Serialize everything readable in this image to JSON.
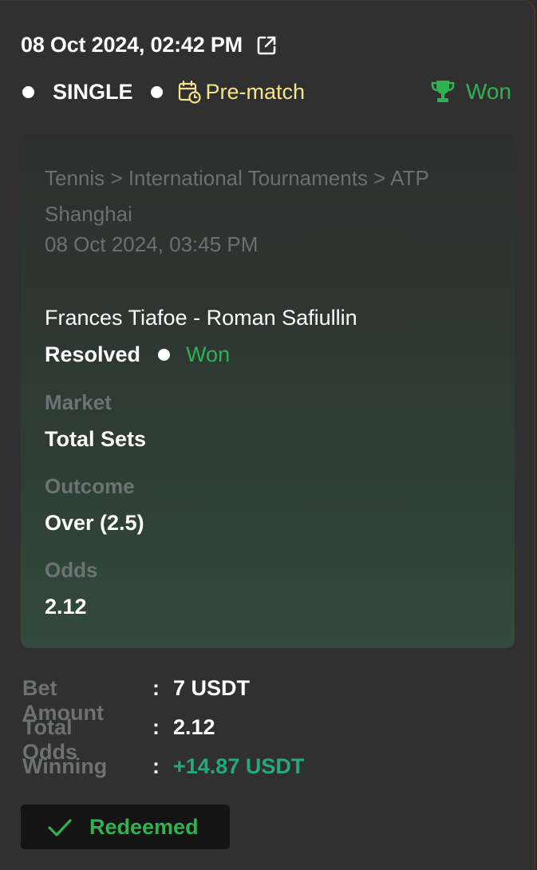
{
  "header": {
    "date": "08 Oct 2024, 02:42 PM",
    "bet_type": "SINGLE",
    "timing": "Pre-match",
    "status": "Won"
  },
  "event": {
    "breadcrumb": "Tennis > International Tournaments > ATP Shanghai",
    "date": "08 Oct 2024, 03:45 PM",
    "match": "Frances Tiafoe - Roman Safiullin",
    "resolution": "Resolved",
    "result": "Won",
    "market_label": "Market",
    "market_value": "Total Sets",
    "outcome_label": "Outcome",
    "outcome_value": "Over (2.5)",
    "odds_label": "Odds",
    "odds_value": "2.12"
  },
  "summary": {
    "bet_amount_label": "Bet Amount",
    "bet_amount_value": "7 USDT",
    "total_odds_label": "Total Odds",
    "total_odds_value": "2.12",
    "winning_label": "Winning",
    "winning_value": "+14.87 USDT",
    "separator": ":"
  },
  "footer": {
    "redeemed_label": "Redeemed"
  },
  "icons": {
    "external": "external-link-icon",
    "calendar": "calendar-clock-icon",
    "trophy": "trophy-icon",
    "check": "check-icon"
  },
  "colors": {
    "won_green": "#2fb250",
    "winning_green": "#27a87a",
    "prematch_yellow": "#f6e38b",
    "muted_text": "#6c7070"
  }
}
